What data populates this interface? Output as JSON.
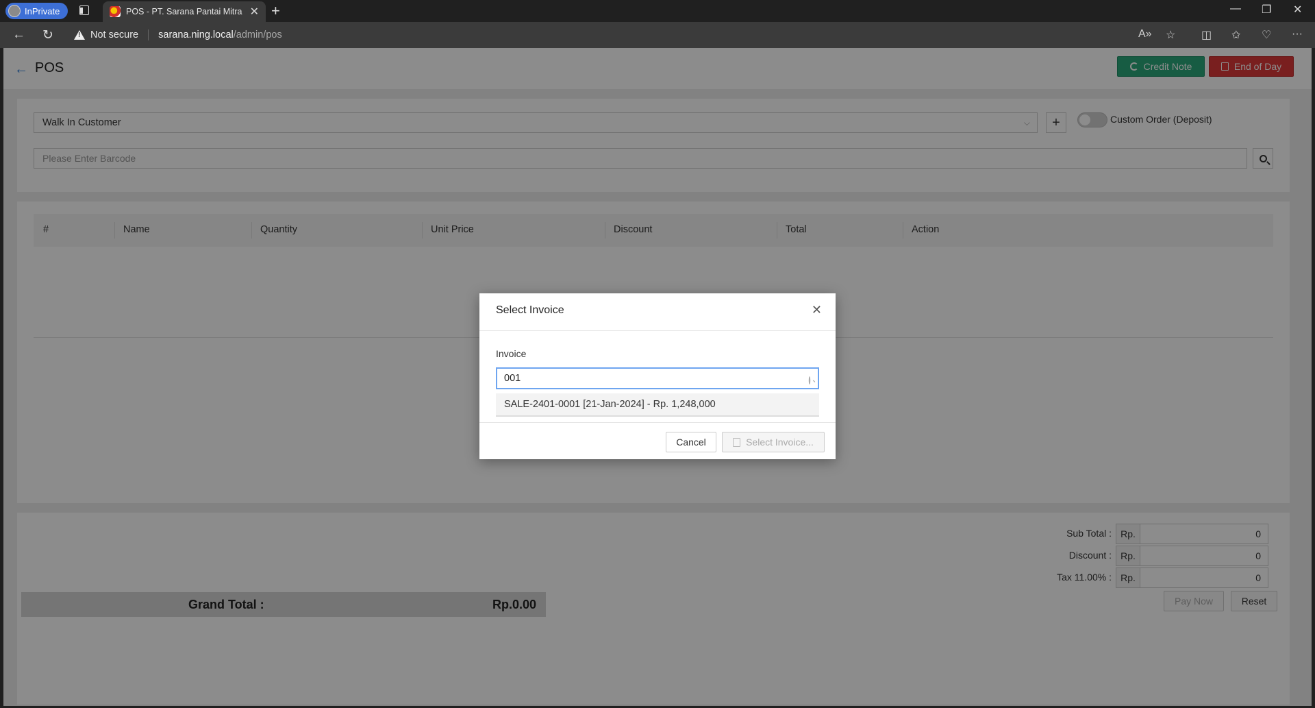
{
  "browser": {
    "inprivate_label": "InPrivate",
    "tab_title": "POS - PT. Sarana Pantai Mitra Se",
    "security_label": "Not secure",
    "url_host": "sarana.ning.local",
    "url_path": "/admin/pos"
  },
  "header": {
    "title": "POS",
    "credit_note_label": "Credit Note",
    "end_of_day_label": "End of Day"
  },
  "customer": {
    "selected": "Walk In Customer",
    "custom_order_label": "Custom Order (Deposit)",
    "barcode_placeholder": "Please Enter Barcode"
  },
  "table": {
    "columns": [
      "#",
      "Name",
      "Quantity",
      "Unit Price",
      "Discount",
      "Total",
      "Action"
    ]
  },
  "totals": {
    "sub_total_label": "Sub Total :",
    "discount_label": "Discount :",
    "tax_label": "Tax 11.00% :",
    "currency": "Rp.",
    "sub_total": "0",
    "discount": "0",
    "tax": "0",
    "grand_total_label": "Grand Total :",
    "grand_total": "Rp.0.00",
    "pay_now_label": "Pay Now",
    "reset_label": "Reset"
  },
  "modal": {
    "title": "Select Invoice",
    "field_label": "Invoice",
    "search_value": "001",
    "options": [
      "SALE-2401-0001 [21-Jan-2024] - Rp. 1,248,000"
    ],
    "cancel_label": "Cancel",
    "select_label": "Select Invoice..."
  },
  "colors": {
    "credit_note": "#2aa87a",
    "end_of_day": "#dd3939",
    "accent": "#2f7bd6"
  }
}
